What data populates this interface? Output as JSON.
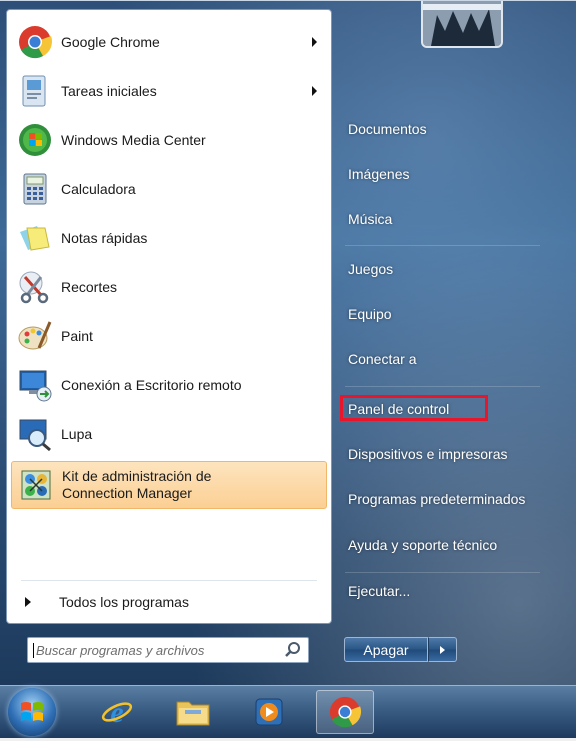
{
  "pinned_programs": [
    {
      "label": "Google Chrome",
      "icon": "chrome-icon",
      "submenu": true
    },
    {
      "label": "Tareas iniciales",
      "icon": "getting-started-icon",
      "submenu": true
    },
    {
      "label": "Windows Media Center",
      "icon": "media-center-icon",
      "submenu": false
    },
    {
      "label": "Calculadora",
      "icon": "calculator-icon",
      "submenu": false
    },
    {
      "label": "Notas rápidas",
      "icon": "sticky-notes-icon",
      "submenu": false
    },
    {
      "label": "Recortes",
      "icon": "snipping-tool-icon",
      "submenu": false
    },
    {
      "label": "Paint",
      "icon": "paint-icon",
      "submenu": false
    },
    {
      "label": "Conexión a Escritorio remoto",
      "icon": "remote-desktop-icon",
      "submenu": false
    },
    {
      "label": "Lupa",
      "icon": "magnifier-icon",
      "submenu": false
    }
  ],
  "highlighted_program": {
    "line1": "Kit de administración de",
    "line2": "Connection Manager",
    "icon": "connection-manager-icon"
  },
  "all_programs_label": "Todos los programas",
  "search": {
    "placeholder": "Buscar programas y archivos"
  },
  "right_items": [
    "Documentos",
    "Imágenes",
    "Música",
    "Juegos",
    "Equipo",
    "Conectar a",
    "Panel de control",
    "Dispositivos e impresoras",
    "Programas predeterminados",
    "Ayuda y soporte técnico",
    "Ejecutar..."
  ],
  "shutdown_label": "Apagar",
  "highlight_color": "#e8152b",
  "taskbar": {
    "items": [
      "windows-orb-icon",
      "internet-explorer-icon",
      "file-explorer-icon",
      "media-player-icon",
      "chrome-icon"
    ]
  }
}
